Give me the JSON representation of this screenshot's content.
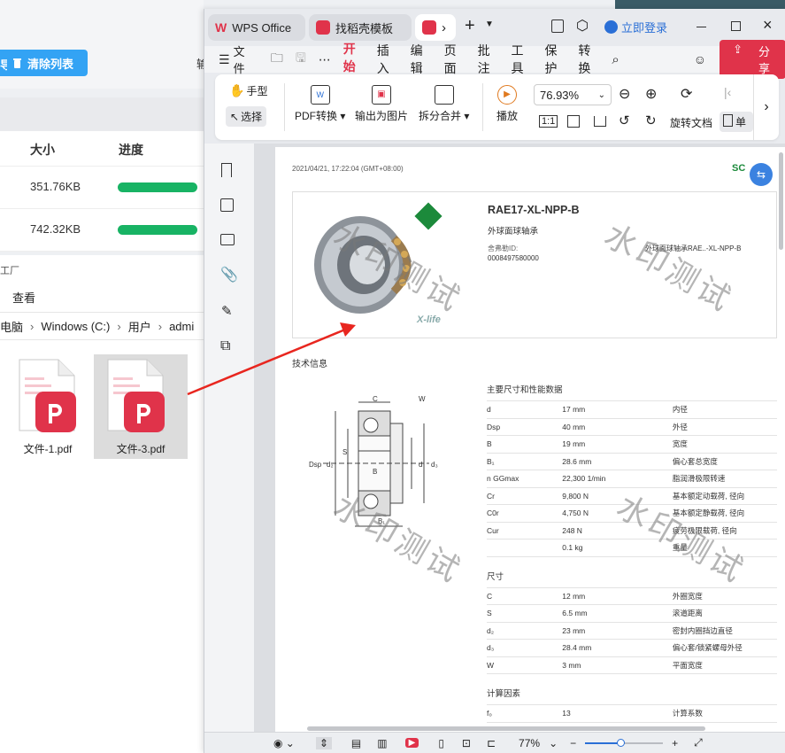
{
  "bg_app": {
    "clear_list_label": "清除列表",
    "col_size": "大小",
    "col_progress": "进度",
    "rows": [
      {
        "size": "351.76KB",
        "progress": 1.0
      },
      {
        "size": "742.32KB",
        "progress": 1.0
      }
    ],
    "explorer_title": "工厂",
    "view_label": "查看",
    "breadcrumb": [
      "电脑",
      "Windows (C:)",
      "用户",
      "admi"
    ],
    "files": [
      "文件-1.pdf",
      "文件-3.pdf"
    ],
    "partial_left_char": "导",
    "partial_mid_char": "输"
  },
  "wps": {
    "tabs": {
      "wps_office": "WPS Office",
      "template": "找稻壳模板"
    },
    "login": "立即登录",
    "share": "分享",
    "menu": [
      "文件",
      "开始",
      "插入",
      "编辑",
      "页面",
      "批注",
      "工具",
      "保护",
      "转换"
    ],
    "active_menu": "开始",
    "ribbon": {
      "hand": "手型",
      "select": "选择",
      "pdf_convert": "PDF转换",
      "export_image": "输出为图片",
      "split_merge": "拆分合并",
      "play": "播放",
      "zoom": "76.93%",
      "rotate": "旋转文档",
      "single": "单"
    },
    "status": {
      "zoom": "77%"
    }
  },
  "doc": {
    "timestamp": "2021/04/21, 17:22:04 (GMT+08:00)",
    "brand_partial": "SC",
    "product_code": "RAE17-XL-NPP-B",
    "product_name": "外球面球轴承",
    "material_label": "舍弗勒ID:",
    "material_id": "0008497580000",
    "short_desc": "外球面球轴承RAE..-XL-NPP-B",
    "logo_text": "X-life",
    "tech_info": "技术信息",
    "main_dims_title": "主要尺寸和性能数据",
    "main_dims": [
      {
        "sym": "d",
        "val": "17  mm",
        "desc": "内径"
      },
      {
        "sym": "Dsp",
        "val": "40  mm",
        "desc": "外径"
      },
      {
        "sym": "B",
        "val": "19  mm",
        "desc": "宽度"
      },
      {
        "sym": "B₁",
        "val": "28.6  mm",
        "desc": "偏心套总宽度"
      },
      {
        "sym": "n GGmax",
        "val": "22,300  1/min",
        "desc": "脂润滑极限转速"
      },
      {
        "sym": "Cr",
        "val": "9,800  N",
        "desc": "基本额定动载荷, 径向"
      },
      {
        "sym": "C0r",
        "val": "4,750  N",
        "desc": "基本额定静载荷, 径向"
      },
      {
        "sym": "Cur",
        "val": "248  N",
        "desc": "疲劳极限载荷, 径向"
      },
      {
        "sym": "",
        "val": "0.1  kg",
        "desc": "重量"
      }
    ],
    "dims_title": "尺寸",
    "dims": [
      {
        "sym": "C",
        "val": "12  mm",
        "desc": "外圈宽度"
      },
      {
        "sym": "S",
        "val": "6.5  mm",
        "desc": "滚道距离"
      },
      {
        "sym": "d₂",
        "val": "23  mm",
        "desc": "密封内圈挡边直径"
      },
      {
        "sym": "d₃",
        "val": "28.4  mm",
        "desc": "偏心套/锁紧螺母外径"
      },
      {
        "sym": "W",
        "val": "3  mm",
        "desc": "平面宽度"
      }
    ],
    "calc_title": "计算因素",
    "calc": [
      {
        "sym": "f₀",
        "val": "13",
        "desc": "计算系数"
      }
    ],
    "watermark": "水印测试",
    "diagram_labels": {
      "C": "C",
      "W": "W",
      "S": "S",
      "B": "B",
      "B1": "B₁",
      "Dsp": "Dsp",
      "d2": "d₂",
      "d": "d",
      "d3": "d₃"
    }
  },
  "colors": {
    "accent_red": "#e0334a",
    "progress_green": "#18b364",
    "clear_btn": "#33a3f4",
    "login_blue": "#2a6fd6"
  }
}
